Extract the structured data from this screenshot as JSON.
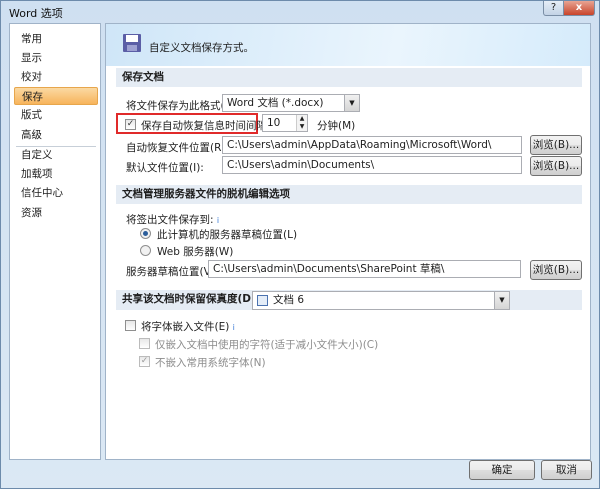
{
  "window": {
    "title": "Word 选项",
    "help": "?",
    "close": "x"
  },
  "sidebar": {
    "items": [
      {
        "label": "常用"
      },
      {
        "label": "显示"
      },
      {
        "label": "校对"
      },
      {
        "label": "保存"
      },
      {
        "label": "版式"
      },
      {
        "label": "高级"
      },
      {
        "label": "自定义"
      },
      {
        "label": "加载项"
      },
      {
        "label": "信任中心"
      },
      {
        "label": "资源"
      }
    ],
    "selected": "保存"
  },
  "header": {
    "text": "自定义文档保存方式。"
  },
  "save_section": {
    "title": "保存文档",
    "format_label": "将文件保存为此格式(F):",
    "format_value": "Word 文档 (*.docx)",
    "autorecover_label": "保存自动恢复信息时间间隔(A)",
    "autorecover_checked": true,
    "autorecover_minutes": "10",
    "minutes_label": "分钟(M)",
    "autorecover_path_label": "自动恢复文件位置(R):",
    "autorecover_path": "C:\\Users\\admin\\AppData\\Roaming\\Microsoft\\Word\\",
    "default_path_label": "默认文件位置(I):",
    "default_path": "C:\\Users\\admin\\Documents\\",
    "browse": "浏览(B)..."
  },
  "server_section": {
    "title": "文档管理服务器文件的脱机编辑选项",
    "checkout_label": "将签出文件保存到:",
    "info": "i",
    "radio_local": "此计算机的服务器草稿位置(L)",
    "radio_web": "Web 服务器(W)",
    "selected": "local",
    "drafts_label": "服务器草稿位置(V):",
    "drafts_path": "C:\\Users\\admin\\Documents\\SharePoint 草稿\\",
    "browse": "浏览(B)..."
  },
  "share_section": {
    "title": "共享该文档时保留保真度(D):",
    "document": "文档 6",
    "embed_fonts": "将字体嵌入文件(E)",
    "embed_fonts_checked": false,
    "embed_used_only": "仅嵌入文档中使用的字符(适于减小文件大小)(C)",
    "embed_used_only_checked": false,
    "no_common_fonts": "不嵌入常用系统字体(N)",
    "no_common_fonts_checked": true
  },
  "footer": {
    "ok": "确定",
    "cancel": "取消"
  },
  "colors": {
    "highlight_box": "#e02a2a",
    "selected_nav": "#f7b45c"
  }
}
